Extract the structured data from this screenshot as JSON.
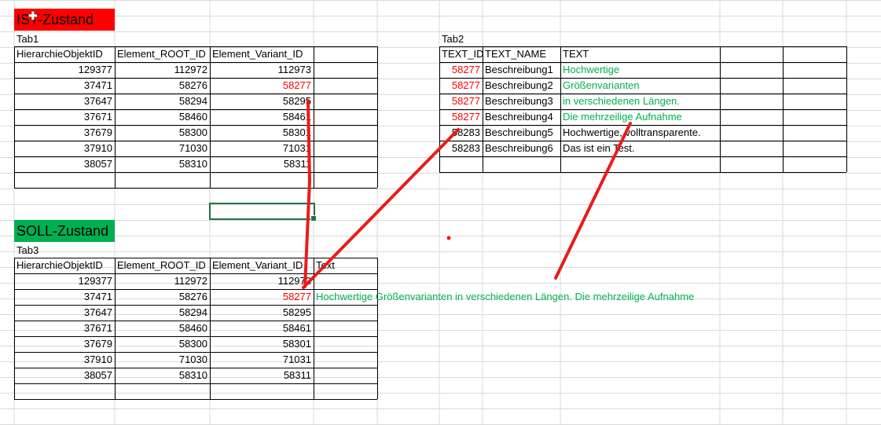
{
  "colors": {
    "ist_banner": "#ff0000",
    "soll_banner": "#00b050",
    "highlight_id": "#ff0000",
    "highlight_text": "#00b050",
    "gridline": "#d9d9d9",
    "border": "#000000",
    "annotation": "#e81c1c"
  },
  "ist": {
    "title": "IST-Zustand"
  },
  "soll": {
    "title": "SOLL-Zustand"
  },
  "tab1": {
    "label": "Tab1",
    "headers": [
      "HierarchieObjektID",
      "Element_ROOT_ID",
      "Element_Variant_ID",
      ""
    ],
    "rows": [
      [
        "129377",
        "112972",
        "112973",
        ""
      ],
      [
        "37471",
        "58276",
        "58277",
        ""
      ],
      [
        "37647",
        "58294",
        "58295",
        ""
      ],
      [
        "37671",
        "58460",
        "58461",
        ""
      ],
      [
        "37679",
        "58300",
        "58301",
        ""
      ],
      [
        "37910",
        "71030",
        "71031",
        ""
      ],
      [
        "38057",
        "58310",
        "58311",
        ""
      ],
      [
        "",
        "",
        "",
        ""
      ]
    ]
  },
  "tab2": {
    "label": "Tab2",
    "headers": [
      "TEXT_ID",
      "TEXT_NAME",
      "TEXT",
      "",
      ""
    ],
    "rows": [
      [
        "58277",
        "Beschreibung1",
        "Hochwertige",
        "",
        ""
      ],
      [
        "58277",
        "Beschreibung2",
        "Größenvarianten",
        "",
        ""
      ],
      [
        "58277",
        "Beschreibung3",
        "in verschiedenen Längen.",
        "",
        ""
      ],
      [
        "58277",
        "Beschreibung4",
        "Die mehrzeilige Aufnahme",
        "",
        ""
      ],
      [
        "58283",
        "Beschreibung5",
        "Hochwertige, volltransparente.",
        "",
        ""
      ],
      [
        "58283",
        "Beschreibung6",
        "Das ist ein Test.",
        "",
        ""
      ],
      [
        "",
        "",
        "",
        "",
        ""
      ]
    ]
  },
  "tab3": {
    "label": "Tab3",
    "headers": [
      "HierarchieObjektID",
      "Element_ROOT_ID",
      "Element_Variant_ID",
      "Text"
    ],
    "rows": [
      [
        "129377",
        "112972",
        "112973",
        ""
      ],
      [
        "37471",
        "58276",
        "58277",
        "Hochwertige Größenvarianten in verschiedenen Längen. Die mehrzeilige Aufnahme"
      ],
      [
        "37647",
        "58294",
        "58295",
        ""
      ],
      [
        "37671",
        "58460",
        "58461",
        ""
      ],
      [
        "37679",
        "58300",
        "58301",
        ""
      ],
      [
        "37910",
        "71030",
        "71031",
        ""
      ],
      [
        "38057",
        "58310",
        "58311",
        ""
      ],
      [
        "",
        "",
        "",
        ""
      ]
    ]
  }
}
